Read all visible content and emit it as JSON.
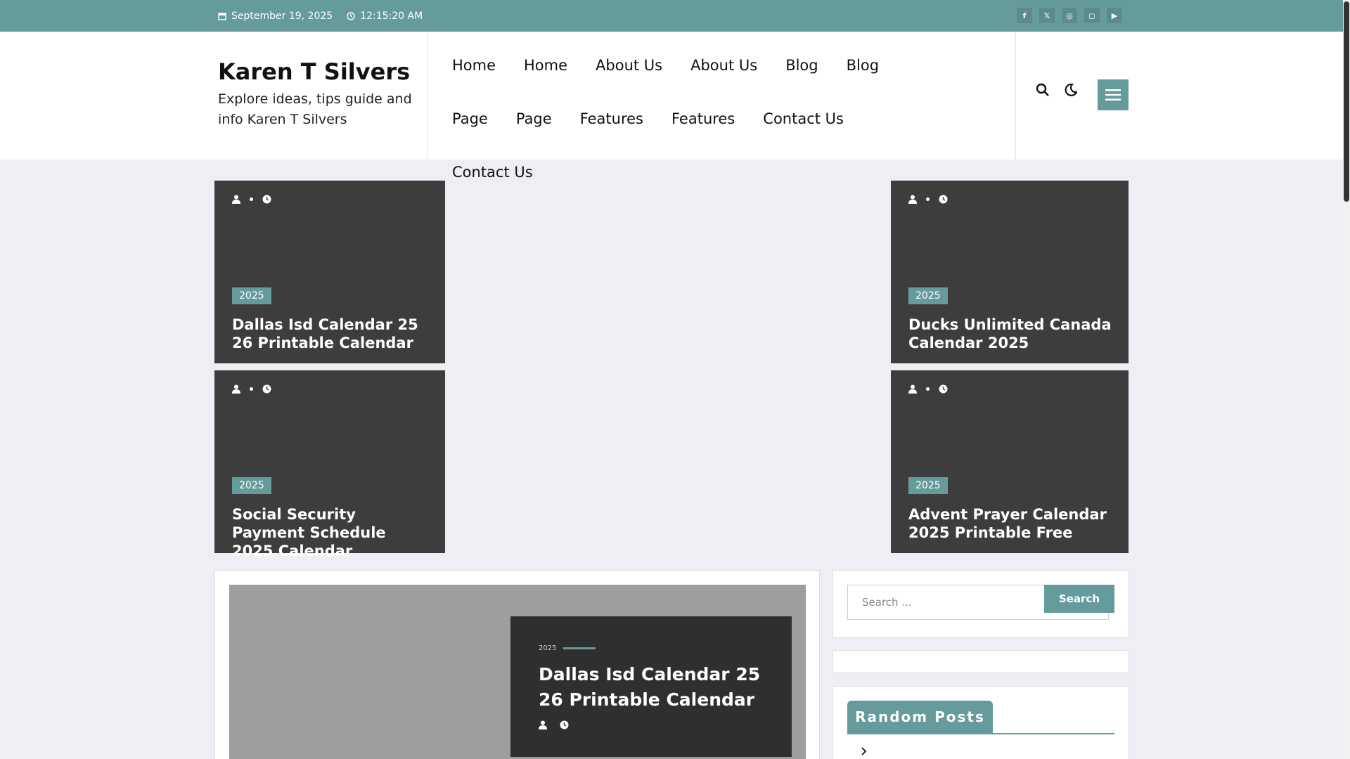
{
  "topbar": {
    "date": "September 19, 2025",
    "time": "12:15:20 AM",
    "social": [
      {
        "icon": "facebook-icon",
        "glyph": "f"
      },
      {
        "icon": "x-icon",
        "glyph": "𝕏"
      },
      {
        "icon": "dribbble-icon",
        "glyph": "◎"
      },
      {
        "icon": "instagram-icon",
        "glyph": "◻"
      },
      {
        "icon": "youtube-icon",
        "glyph": "▶"
      }
    ]
  },
  "brand": {
    "title": "Karen T Silvers",
    "tagline": "Explore ideas, tips guide and info Karen T Silvers"
  },
  "nav": {
    "items": [
      "Home",
      "Home",
      "About Us",
      "About Us",
      "Blog",
      "Blog",
      "Page",
      "Page",
      "Features",
      "Features",
      "Contact Us",
      "Contact Us"
    ]
  },
  "tiles": [
    {
      "badge": "2025",
      "title": "Dallas Isd Calendar 25 26 Printable Calendar"
    },
    {
      "badge": "2025",
      "title": "Ducks Unlimited Canada Calendar 2025"
    },
    {
      "badge": "2025",
      "title": "Social Security Payment Schedule 2025 Calendar"
    },
    {
      "badge": "2025",
      "title": "Advent Prayer Calendar 2025 Printable Free"
    }
  ],
  "featured": {
    "category": "2025",
    "title": "Dallas Isd Calendar 25 26 Printable Calendar"
  },
  "sidebar": {
    "search_placeholder": "Search ...",
    "search_button": "Search",
    "random_posts_title": "Random Posts"
  },
  "colors": {
    "accent": "#669b9c",
    "tile_bg": "#3d3d3d"
  }
}
